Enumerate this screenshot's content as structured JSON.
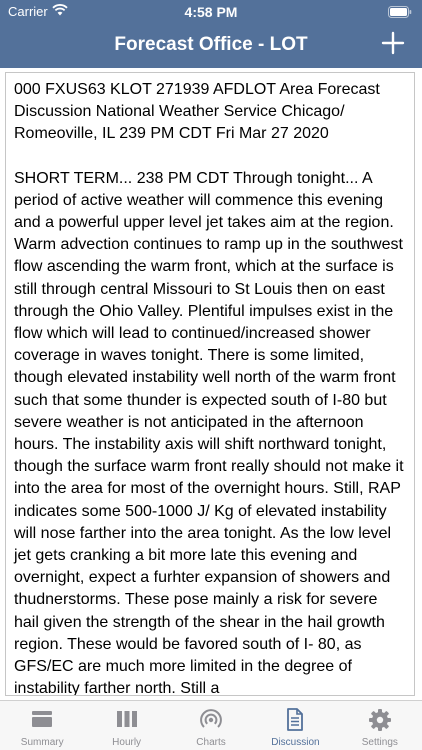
{
  "status_bar": {
    "carrier": "Carrier",
    "time": "4:58 PM"
  },
  "nav": {
    "title": "Forecast Office - LOT",
    "add_icon": "plus-icon"
  },
  "discussion": {
    "paragraphs": [
      "000 FXUS63 KLOT 271939 AFDLOT  Area Forecast Discussion National Weather Service Chicago/ Romeoville, IL 239 PM CDT Fri Mar 27 2020",
      "SHORT TERM... 238 PM CDT  Through tonight...  A period of active weather will commence this evening and a powerful upper level jet takes aim at the region. Warm advection continues to ramp up in the southwest flow ascending the warm front, which at the surface is still through central Missouri to St Louis then on east through the Ohio Valley. Plentiful impulses exist in the flow which will lead to continued/increased shower coverage in waves tonight.  There is some limited, though elevated instability well north of the warm front such that some thunder is expected south of I-80 but severe weather is not anticipated in the afternoon hours.  The instability axis will shift northward tonight, though the surface warm front really should not make it into the area for most of the overnight hours. Still, RAP indicates some 500-1000 J/ Kg of elevated instability will nose farther into the area tonight. As the low level jet gets cranking a bit more late this evening and overnight, expect a furhter expansion of showers and thudnerstorms. These pose mainly a risk for severe hail given the strength of the shear in the hail growth region. These would be favored south of I- 80, as GFS/EC are much more limited in the degree of instability farther north. Still a"
    ]
  },
  "tabs": [
    {
      "label": "Summary",
      "icon": "summary-icon",
      "active": false
    },
    {
      "label": "Hourly",
      "icon": "hourly-bars-icon",
      "active": false
    },
    {
      "label": "Charts",
      "icon": "radar-icon",
      "active": false
    },
    {
      "label": "Discussion",
      "icon": "document-icon",
      "active": true
    },
    {
      "label": "Settings",
      "icon": "gear-icon",
      "active": false
    }
  ],
  "colors": {
    "header": "#53719a",
    "tab_active": "#53719a",
    "tab_inactive": "#8e8e93"
  }
}
